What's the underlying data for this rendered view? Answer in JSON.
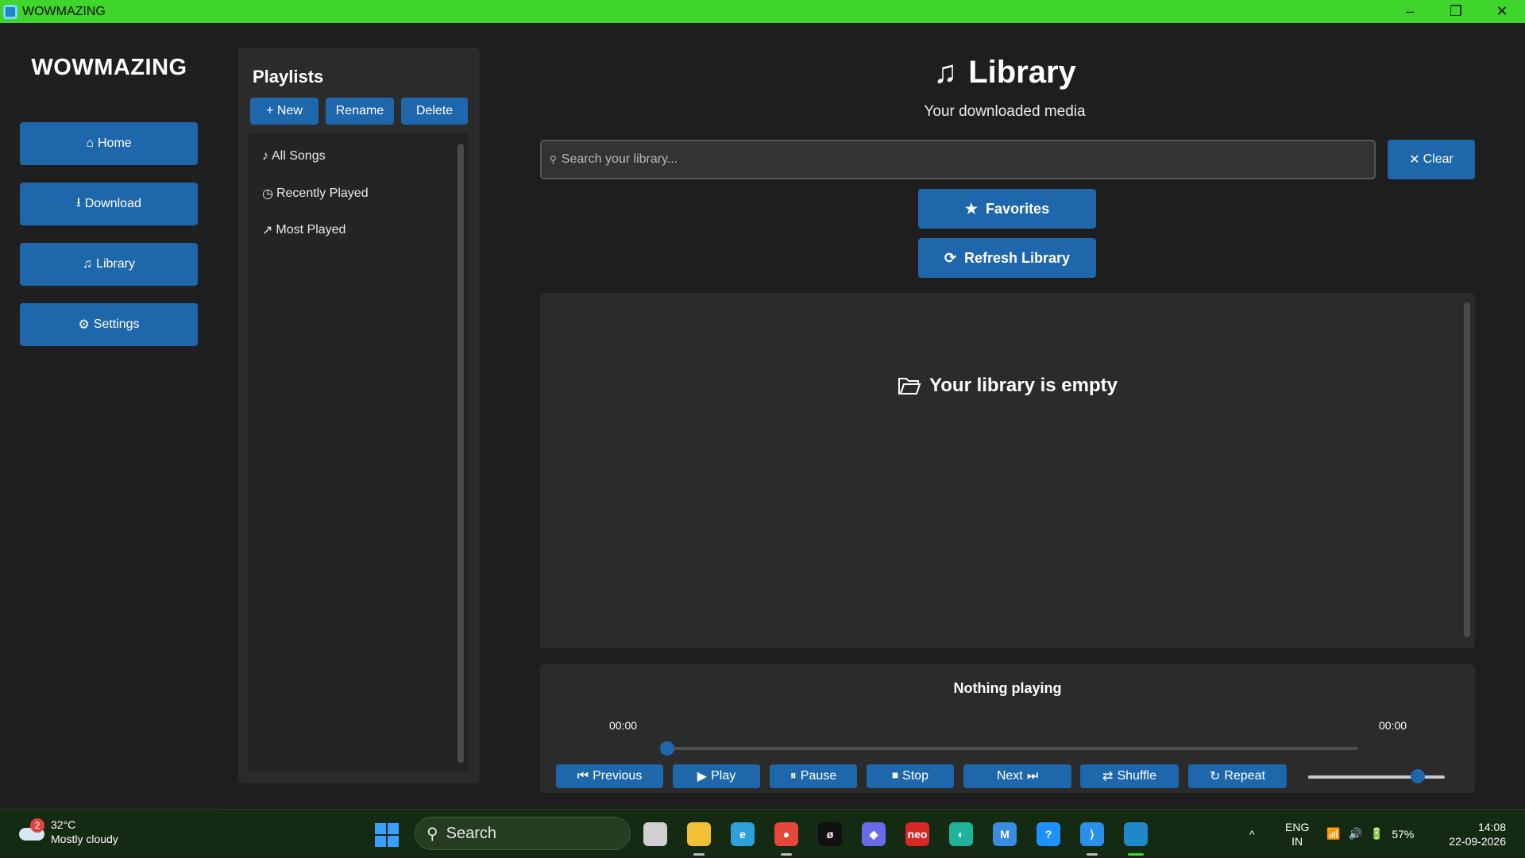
{
  "window": {
    "title": "WOWMAZING",
    "minimize": "–",
    "maximize": "❐",
    "close": "✕"
  },
  "sidebar": {
    "brand": "WOWMAZING",
    "items": [
      {
        "icon": "⌂",
        "label": "Home"
      },
      {
        "icon": "⭳",
        "label": "Download"
      },
      {
        "icon": "♫",
        "label": "Library"
      },
      {
        "icon": "⚙",
        "label": "Settings"
      }
    ]
  },
  "playlists": {
    "title": "Playlists",
    "new_label": "+ New",
    "rename_label": "Rename",
    "delete_label": "Delete",
    "items": [
      {
        "icon": "♪",
        "label": "All Songs"
      },
      {
        "icon": "◷",
        "label": "Recently Played"
      },
      {
        "icon": "↗",
        "label": "Most Played"
      }
    ]
  },
  "library": {
    "icon": "♫",
    "title": "Library",
    "subtitle": "Your downloaded media",
    "search_placeholder": "Search your library...",
    "clear_label": "Clear",
    "favorites_label": "Favorites",
    "refresh_label": "Refresh Library",
    "empty_message": "Your library is empty"
  },
  "player": {
    "now_playing": "Nothing playing",
    "time_current": "00:00",
    "time_total": "00:00",
    "progress": 0,
    "volume": 0.8,
    "controls": [
      "Previous",
      "Play",
      "Pause",
      "Stop",
      "Next",
      "Shuffle",
      "Repeat"
    ]
  },
  "taskbar": {
    "weather": {
      "temp": "32°C",
      "condition": "Mostly cloudy",
      "badge": "2"
    },
    "search_label": "Search",
    "apps": [
      {
        "name": "task-view",
        "color": "#d0d0d0",
        "glyph": ""
      },
      {
        "name": "file-explorer",
        "color": "#f2c037",
        "glyph": ""
      },
      {
        "name": "edge",
        "color": "#2fa0d8",
        "glyph": "e"
      },
      {
        "name": "chrome",
        "color": "#e5483b",
        "glyph": "●"
      },
      {
        "name": "app-black",
        "color": "#111111",
        "glyph": "ø"
      },
      {
        "name": "copilot",
        "color": "#6a6ae8",
        "glyph": "◆"
      },
      {
        "name": "neo",
        "color": "#d82929",
        "glyph": "neo"
      },
      {
        "name": "wave-app",
        "color": "#1fb39a",
        "glyph": "◐"
      },
      {
        "name": "m365",
        "color": "#3b8be0",
        "glyph": "M"
      },
      {
        "name": "help",
        "color": "#1e90ff",
        "glyph": "?"
      },
      {
        "name": "vscode",
        "color": "#2a8fe8",
        "glyph": "⟩"
      },
      {
        "name": "wowmazing-app",
        "color": "#1e88c8",
        "glyph": ""
      }
    ],
    "tray": {
      "chevron": "^",
      "lang": "ENG",
      "region": "IN",
      "battery": "57%",
      "time": "14:08",
      "date": "22-09-2026"
    }
  },
  "colors": {
    "accent": "#1f67ab",
    "titlebar": "#3fd62c",
    "background": "#1e1e1e",
    "panel": "#2b2b2b"
  }
}
